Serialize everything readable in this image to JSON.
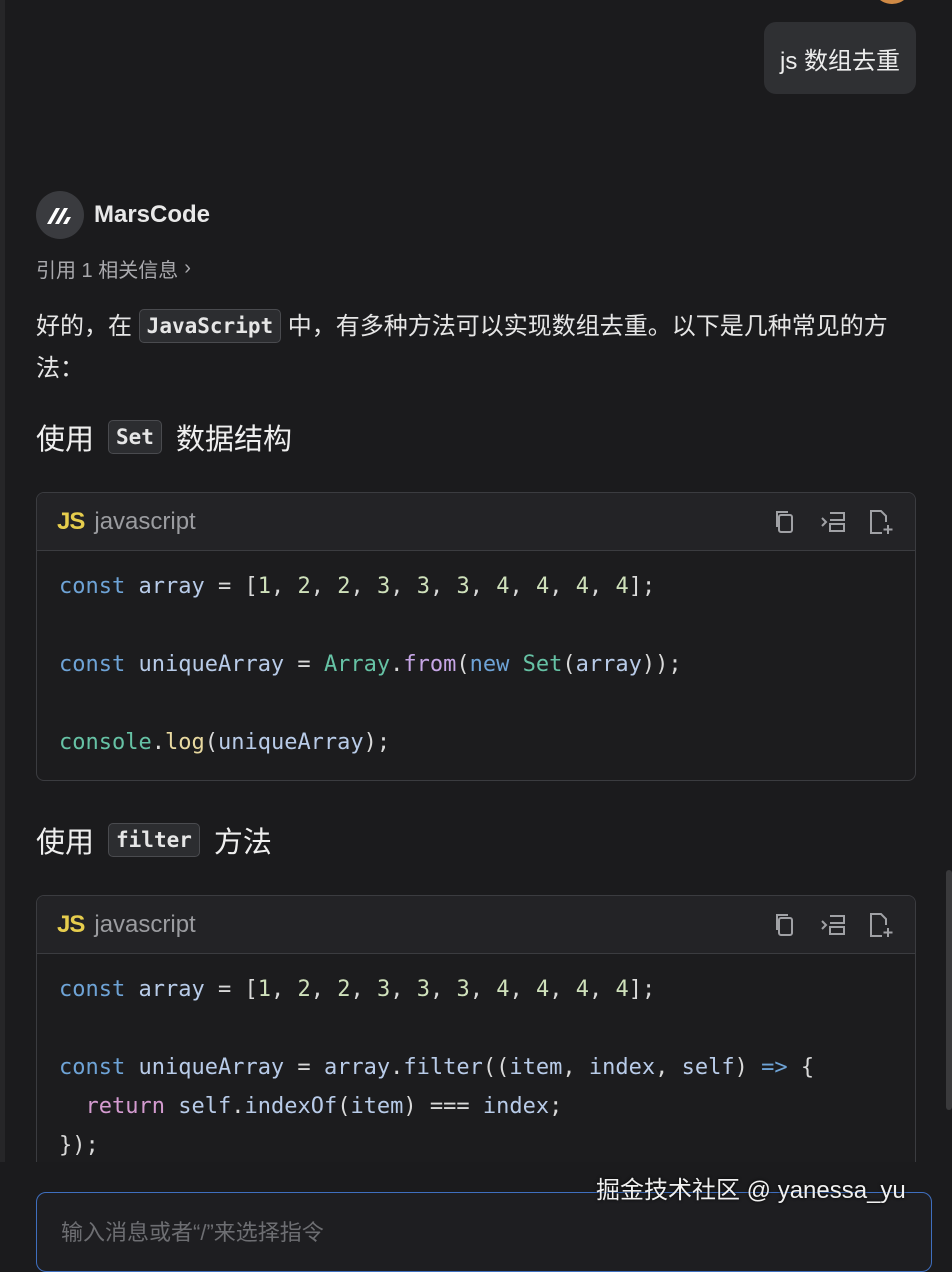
{
  "user_message": "js 数组去重",
  "assistant": {
    "name": "MarsCode",
    "refs_label": "引用 1 相关信息",
    "intro_before": "好的，在",
    "intro_code": "JavaScript",
    "intro_after": "中，有多种方法可以实现数组去重。以下是几种常见的方法："
  },
  "sections": [
    {
      "heading_before": "使用",
      "heading_code": "Set",
      "heading_after": "数据结构",
      "lang_badge": "JS",
      "lang": "javascript",
      "code_lines": [
        "const array = [1, 2, 2, 3, 3, 3, 4, 4, 4, 4];",
        "",
        "const uniqueArray = Array.from(new Set(array));",
        "",
        "console.log(uniqueArray);"
      ]
    },
    {
      "heading_before": "使用",
      "heading_code": "filter",
      "heading_after": "方法",
      "lang_badge": "JS",
      "lang": "javascript",
      "code_lines": [
        "const array = [1, 2, 2, 3, 3, 3, 4, 4, 4, 4];",
        "",
        "const uniqueArray = array.filter((item, index, self) => {",
        "  return self.indexOf(item) === index;",
        "});"
      ]
    }
  ],
  "input": {
    "placeholder": "输入消息或者“/”来选择指令"
  },
  "watermark": "掘金技术社区 @ yanessa_yu",
  "icons": {
    "copy": "copy-icon",
    "insert": "insert-icon",
    "new_file": "new-file-icon",
    "logo": "marscode-logo-icon"
  },
  "colors": {
    "background": "#1b1b1d",
    "accent": "#3f6fbf",
    "js_badge": "#e6cd4d"
  }
}
